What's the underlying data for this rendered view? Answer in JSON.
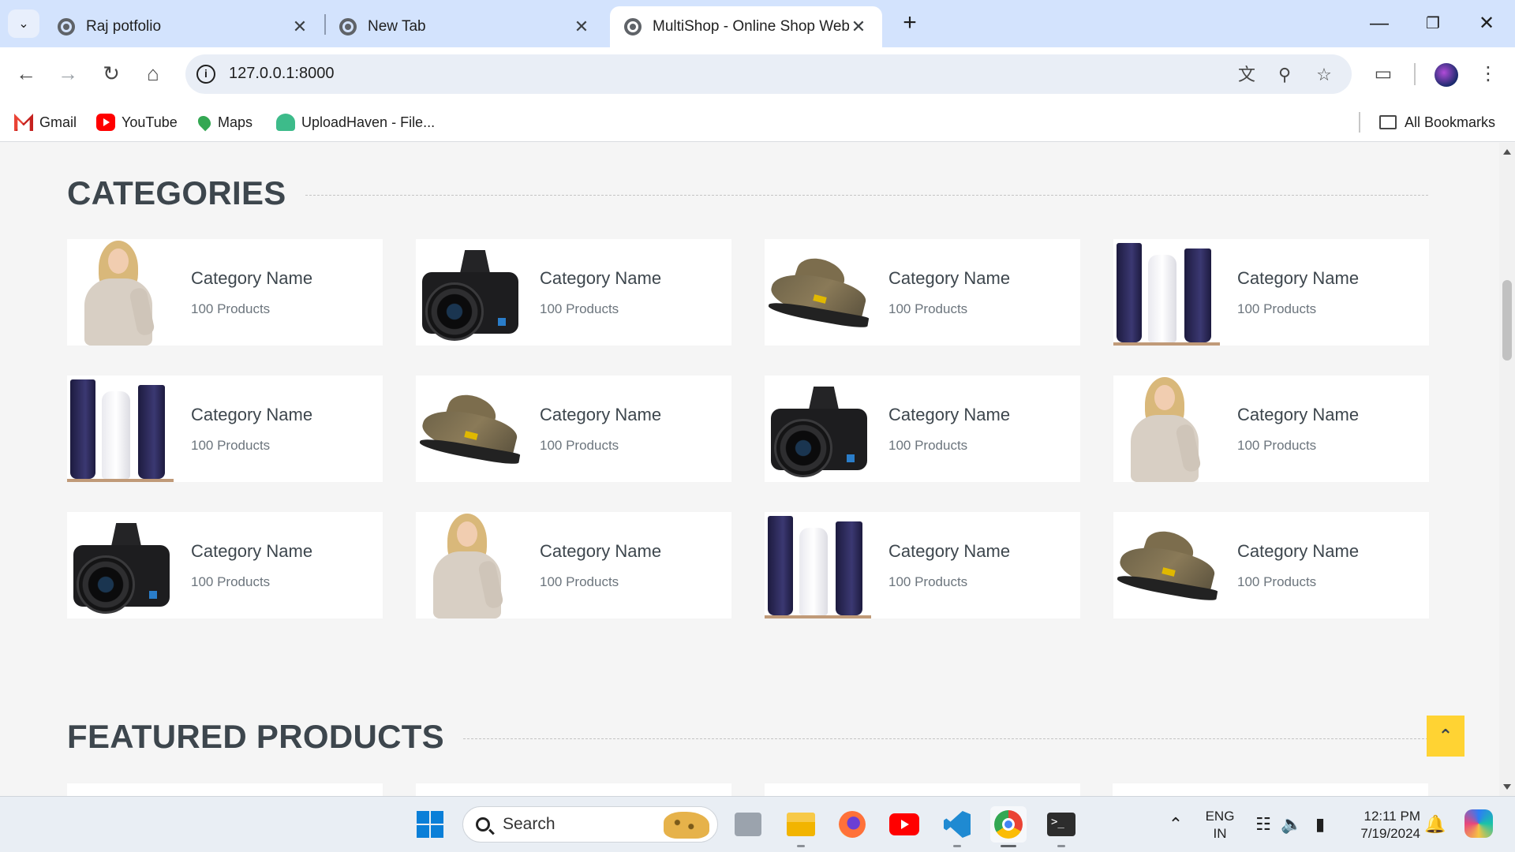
{
  "browser": {
    "tabs": [
      {
        "title": "Raj potfolio",
        "active": false
      },
      {
        "title": "New Tab",
        "active": false
      },
      {
        "title": "MultiShop - Online Shop Website",
        "active": true
      }
    ],
    "url": "127.0.0.1:8000",
    "bookmarks": [
      {
        "label": "Gmail",
        "icon": "gmail-icon"
      },
      {
        "label": "YouTube",
        "icon": "youtube-icon"
      },
      {
        "label": "Maps",
        "icon": "maps-icon"
      },
      {
        "label": "UploadHaven - File...",
        "icon": "uploadhaven-icon"
      }
    ],
    "all_bookmarks_label": "All Bookmarks"
  },
  "page": {
    "categories_title": "Categories",
    "featured_title": "Featured Products",
    "categories": [
      {
        "name": "Category Name",
        "count": "100 Products",
        "image": "model"
      },
      {
        "name": "Category Name",
        "count": "100 Products",
        "image": "camera"
      },
      {
        "name": "Category Name",
        "count": "100 Products",
        "image": "shoe"
      },
      {
        "name": "Category Name",
        "count": "100 Products",
        "image": "tubes"
      },
      {
        "name": "Category Name",
        "count": "100 Products",
        "image": "tubes"
      },
      {
        "name": "Category Name",
        "count": "100 Products",
        "image": "shoe"
      },
      {
        "name": "Category Name",
        "count": "100 Products",
        "image": "camera"
      },
      {
        "name": "Category Name",
        "count": "100 Products",
        "image": "model"
      },
      {
        "name": "Category Name",
        "count": "100 Products",
        "image": "camera"
      },
      {
        "name": "Category Name",
        "count": "100 Products",
        "image": "model"
      },
      {
        "name": "Category Name",
        "count": "100 Products",
        "image": "tubes"
      },
      {
        "name": "Category Name",
        "count": "100 Products",
        "image": "shoe"
      }
    ],
    "back_to_top_icon": "double-chevron-up-icon",
    "accent_color": "#ffd333"
  },
  "taskbar": {
    "search_placeholder": "Search",
    "language": {
      "line1": "ENG",
      "line2": "IN"
    },
    "time": "12:11 PM",
    "date": "7/19/2024"
  }
}
